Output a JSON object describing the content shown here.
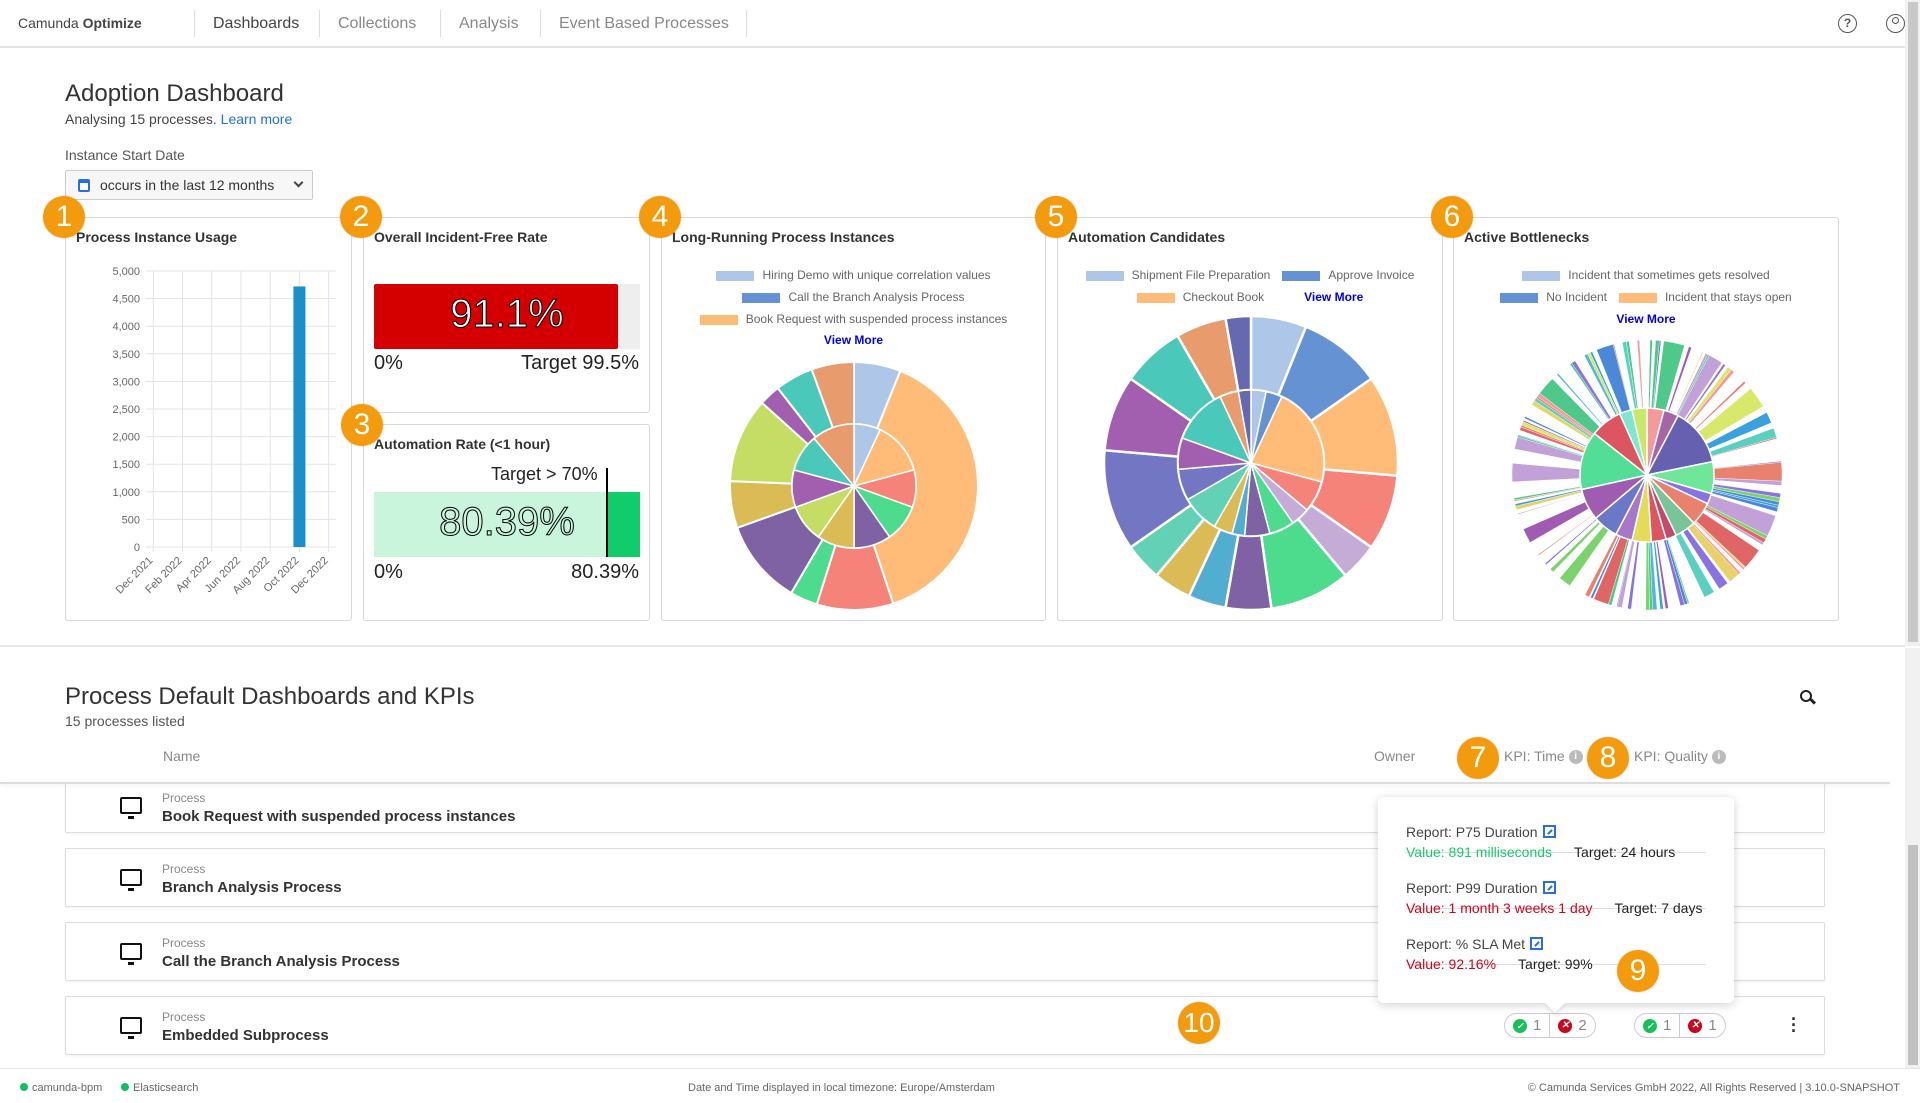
{
  "app": {
    "brand_light": "Camunda",
    "brand_bold": "Optimize"
  },
  "nav": [
    {
      "label": "Dashboards",
      "active": true
    },
    {
      "label": "Collections"
    },
    {
      "label": "Analysis"
    },
    {
      "label": "Event Based Processes"
    }
  ],
  "topright": {
    "help_icon": "help-circle-icon",
    "user_icon": "user-circle-icon"
  },
  "dashboard": {
    "title": "Adoption Dashboard",
    "subtitle": "Analysing 15 processes.",
    "learn_more": "Learn more",
    "filter_label": "Instance Start Date",
    "filter_value": "occurs in the last 12 months"
  },
  "badges": [
    "1",
    "2",
    "3",
    "4",
    "5",
    "6",
    "7",
    "8",
    "9",
    "10"
  ],
  "colors": {
    "accent": "#f39b0c",
    "bar": "#1c8fca",
    "gauge_red": "#d40000",
    "gauge_green_light": "#c8f5dc",
    "gauge_green": "#10cc6a",
    "link": "#0000ee"
  },
  "chart_data": [
    {
      "title": "Process Instance Usage",
      "type": "bar",
      "categories": [
        "Dec 2021",
        "Jan 2022",
        "Feb 2022",
        "Mar 2022",
        "Apr 2022",
        "May 2022",
        "Jun 2022",
        "Jul 2022",
        "Aug 2022",
        "Sep 2022",
        "Oct 2022",
        "Nov 2022",
        "Dec 2022"
      ],
      "tick_labels": [
        "Dec 2021",
        "Feb 2022",
        "Apr 2022",
        "Jun 2022",
        "Aug 2022",
        "Oct 2022",
        "Dec 2022"
      ],
      "values": [
        0,
        0,
        0,
        0,
        0,
        0,
        0,
        0,
        0,
        0,
        4720,
        0,
        0
      ],
      "ylim": [
        0,
        5000
      ],
      "yticks": [
        "5,000",
        "4,500",
        "4,000",
        "3,500",
        "3,000",
        "2,500",
        "2,000",
        "1,500",
        "1,000",
        "500",
        "0"
      ],
      "grid": true
    },
    {
      "title": "Overall Incident-Free Rate",
      "type": "gauge",
      "value": 91.1,
      "value_label": "91.1%",
      "min_label": "0%",
      "target": 99.5,
      "target_label": "Target 99.5%"
    },
    {
      "title": "Automation Rate (<1 hour)",
      "type": "gauge",
      "value": 80.39,
      "value_label": "80.39%",
      "min_label": "0%",
      "max_label": "80.39%",
      "target": 70,
      "target_label": "Target > 70%"
    },
    {
      "title": "Long-Running Process Instances",
      "type": "pie",
      "legend": [
        "Hiring Demo with unique correlation values",
        "Call the Branch Analysis Process",
        "Book Request with suspended process instances"
      ],
      "legend_colors": [
        "#aec7e8",
        "#6592d3",
        "#ffbb78"
      ],
      "view_more": "View More",
      "outer": [
        {
          "v": 22,
          "c": "#aec7e8"
        },
        {
          "v": 140,
          "c": "#ffbb78"
        },
        {
          "v": 36,
          "c": "#f5837a"
        },
        {
          "v": 13,
          "c": "#4ddb8d"
        },
        {
          "v": 40,
          "c": "#7e62a3"
        },
        {
          "v": 22,
          "c": "#dbbb55"
        },
        {
          "v": 40,
          "c": "#c5dc65"
        },
        {
          "v": 10,
          "c": "#a25fb0"
        },
        {
          "v": 18,
          "c": "#4ac9bb"
        },
        {
          "v": 20,
          "c": "#e89b6c"
        }
      ],
      "inner": [
        {
          "v": 25,
          "c": "#aec7e8"
        },
        {
          "v": 50,
          "c": "#ffbb78"
        },
        {
          "v": 35,
          "c": "#f5837a"
        },
        {
          "v": 35,
          "c": "#4ddb8d"
        },
        {
          "v": 35,
          "c": "#7e62a3"
        },
        {
          "v": 35,
          "c": "#dbbb55"
        },
        {
          "v": 35,
          "c": "#c5dc65"
        },
        {
          "v": 35,
          "c": "#a25fb0"
        },
        {
          "v": 35,
          "c": "#4ac9bb"
        },
        {
          "v": 40,
          "c": "#e89b6c"
        }
      ]
    },
    {
      "title": "Automation Candidates",
      "type": "pie",
      "legend": [
        "Shipment File Preparation",
        "Approve Invoice",
        "Checkout Book"
      ],
      "legend_colors": [
        "#aec7e8",
        "#6592d3",
        "#ffbb78"
      ],
      "view_more": "View More",
      "outer": [
        {
          "v": 22,
          "c": "#aec7e8"
        },
        {
          "v": 33,
          "c": "#6592d3"
        },
        {
          "v": 40,
          "c": "#ffbb78"
        },
        {
          "v": 30,
          "c": "#f5837a"
        },
        {
          "v": 15,
          "c": "#c4acd6"
        },
        {
          "v": 32,
          "c": "#4ddb8d"
        },
        {
          "v": 18,
          "c": "#7e62a3"
        },
        {
          "v": 15,
          "c": "#52aed0"
        },
        {
          "v": 15,
          "c": "#dbbb55"
        },
        {
          "v": 15,
          "c": "#62d1b5"
        },
        {
          "v": 40,
          "c": "#7376c2"
        },
        {
          "v": 30,
          "c": "#a25fb0"
        },
        {
          "v": 25,
          "c": "#4ac9bb"
        },
        {
          "v": 20,
          "c": "#e89b6c"
        },
        {
          "v": 10,
          "c": "#6668b0"
        }
      ],
      "inner": [
        {
          "v": 12,
          "c": "#aec7e8"
        },
        {
          "v": 13,
          "c": "#6592d3"
        },
        {
          "v": 80,
          "c": "#ffbb78"
        },
        {
          "v": 25,
          "c": "#f5837a"
        },
        {
          "v": 15,
          "c": "#c4acd6"
        },
        {
          "v": 20,
          "c": "#4ddb8d"
        },
        {
          "v": 20,
          "c": "#7e62a3"
        },
        {
          "v": 10,
          "c": "#52aed0"
        },
        {
          "v": 15,
          "c": "#dbbb55"
        },
        {
          "v": 30,
          "c": "#62d1b5"
        },
        {
          "v": 25,
          "c": "#7376c2"
        },
        {
          "v": 25,
          "c": "#a25fb0"
        },
        {
          "v": 45,
          "c": "#4ac9bb"
        },
        {
          "v": 15,
          "c": "#e89b6c"
        },
        {
          "v": 10,
          "c": "#6668b0"
        }
      ]
    },
    {
      "title": "Active Bottlenecks",
      "type": "pie",
      "legend": [
        "Incident that sometimes gets resolved",
        "No Incident",
        "Incident that stays open"
      ],
      "legend_colors": [
        "#aec7e8",
        "#6592d3",
        "#ffbb78"
      ],
      "view_more": "View More",
      "inner": [
        {
          "v": 16,
          "c": "#f59a9a"
        },
        {
          "v": 14,
          "c": "#a566a8"
        },
        {
          "v": 55,
          "c": "#6660b0"
        },
        {
          "v": 30,
          "c": "#6ee79a"
        },
        {
          "v": 10,
          "c": "#8a73e0"
        },
        {
          "v": 22,
          "c": "#e8826e"
        },
        {
          "v": 20,
          "c": "#7ac49a"
        },
        {
          "v": 10,
          "c": "#c24a6a"
        },
        {
          "v": 14,
          "c": "#dc5560"
        },
        {
          "v": 18,
          "c": "#e2dc58"
        },
        {
          "v": 16,
          "c": "#a877c8"
        },
        {
          "v": 24,
          "c": "#6a78c8"
        },
        {
          "v": 30,
          "c": "#a05cb0"
        },
        {
          "v": 55,
          "c": "#52de96"
        },
        {
          "v": 30,
          "c": "#dc5560"
        },
        {
          "v": 12,
          "c": "#7de8cf"
        },
        {
          "v": 14,
          "c": "#c8e86a"
        }
      ],
      "outer_slice_count": 180
    }
  ],
  "kpis": {
    "title": "Process Default Dashboards and KPIs",
    "subtitle": "15 processes listed",
    "search_icon": "search-icon",
    "columns": {
      "name": "Name",
      "owner": "Owner",
      "kpi_time": "KPI: Time",
      "kpi_quality": "KPI: Quality"
    },
    "rows": [
      {
        "type": "Process",
        "name": "Book Request with suspended process instances"
      },
      {
        "type": "Process",
        "name": "Branch Analysis Process"
      },
      {
        "type": "Process",
        "name": "Call the Branch Analysis Process"
      },
      {
        "type": "Process",
        "name": "Embedded Subprocess",
        "kpi_time": {
          "ok": "1",
          "fail": "2"
        },
        "kpi_quality": {
          "ok": "1",
          "fail": "1"
        }
      }
    ],
    "tooltip": [
      {
        "report": "Report: P75 Duration",
        "value": "Value: 891 milliseconds",
        "status": "good",
        "target": "Target: 24 hours"
      },
      {
        "report": "Report: P99 Duration",
        "value": "Value: 1 month 3 weeks 1 day",
        "status": "bad",
        "target": "Target: 7 days"
      },
      {
        "report": "Report: % SLA Met",
        "value": "Value: 92.16%",
        "status": "bad",
        "target": "Target: 99%"
      }
    ]
  },
  "footer": {
    "status": [
      "camunda-bpm",
      "Elasticsearch"
    ],
    "timezone": "Date and Time displayed in local timezone: Europe/Amsterdam",
    "copyright": "© Camunda Services GmbH 2022, All Rights Reserved | 3.10.0-SNAPSHOT"
  }
}
